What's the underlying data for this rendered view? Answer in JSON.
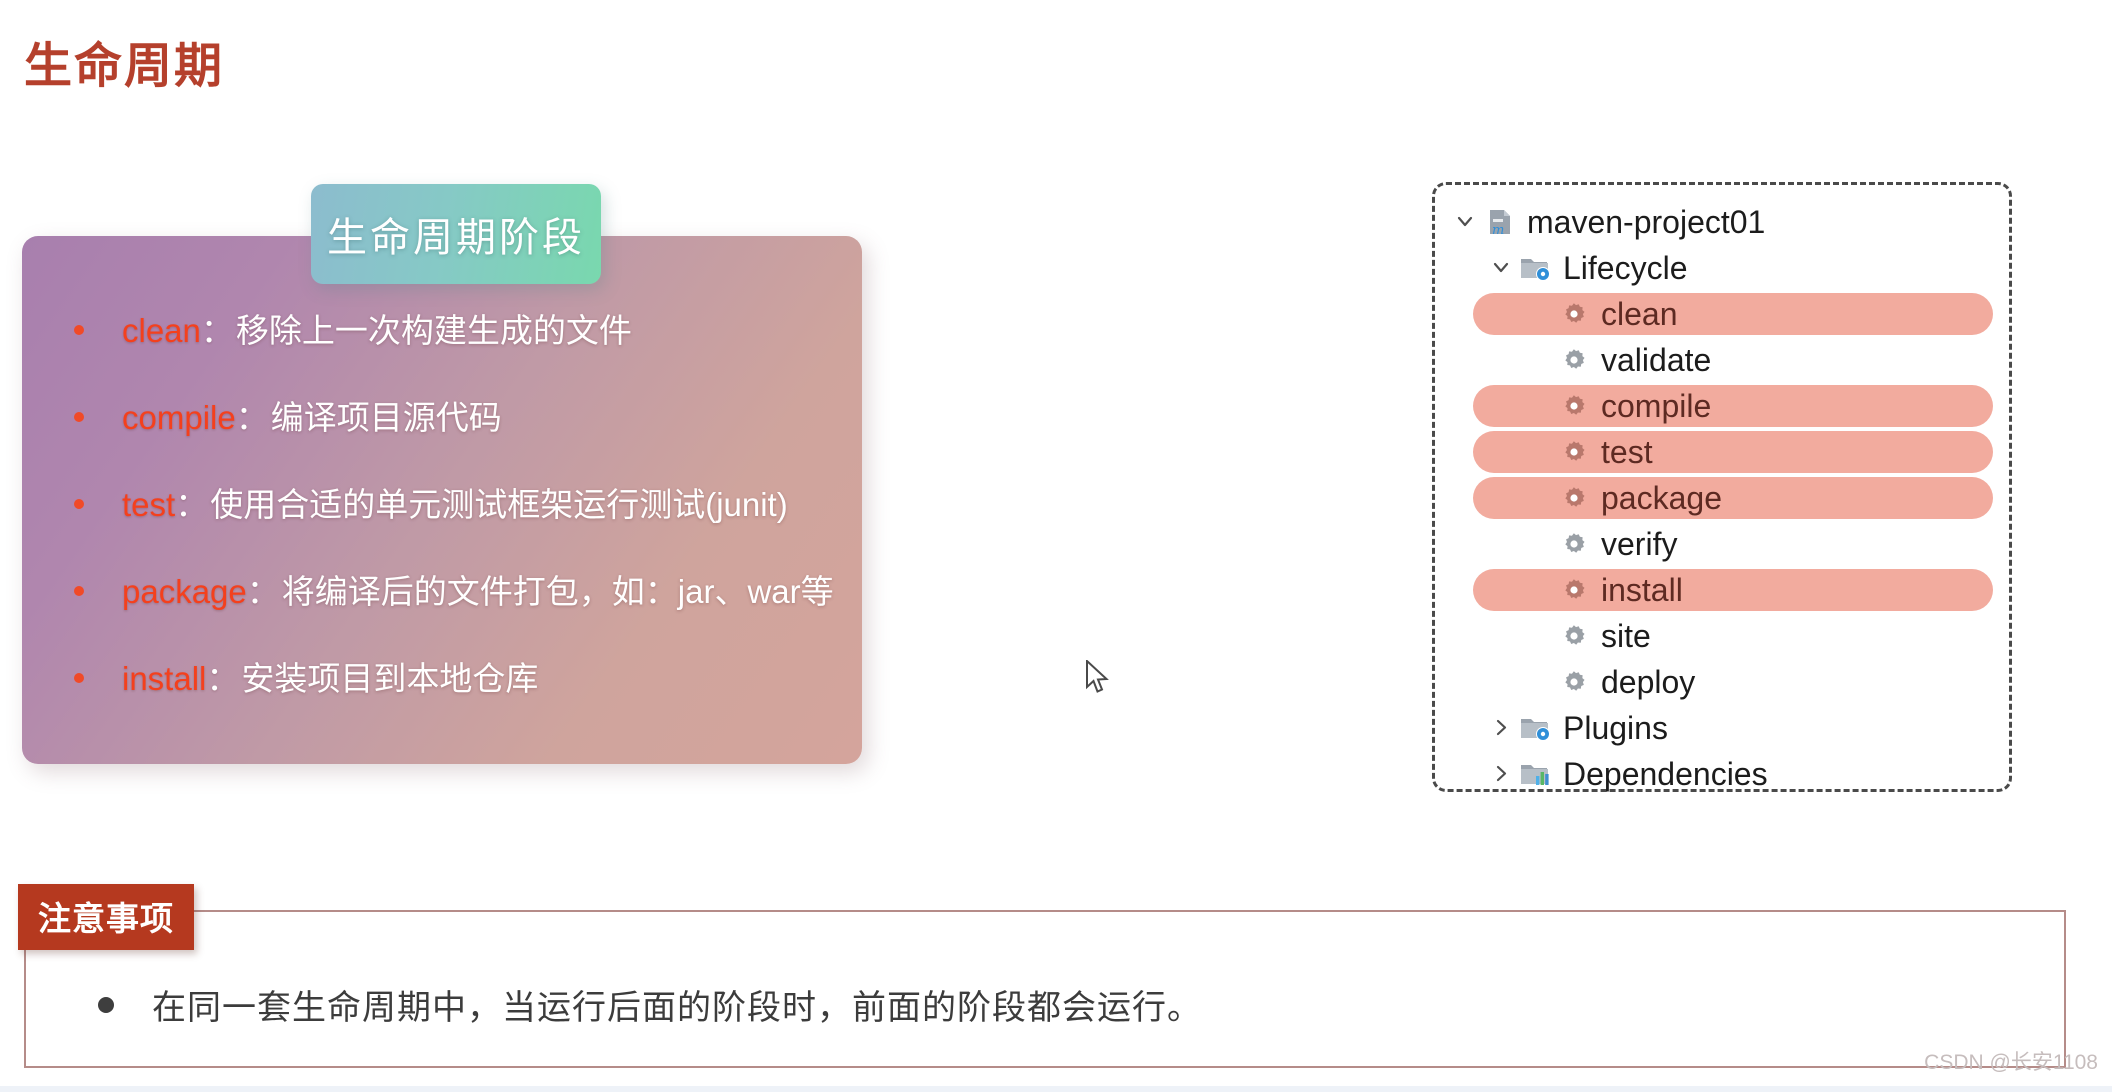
{
  "page": {
    "title": "生命周期",
    "title_color": "#b5402c"
  },
  "lifecycle_card": {
    "tag_label": "生命周期阶段",
    "tag_gradient_from": "#8cbcce",
    "tag_gradient_to": "#79d8ae",
    "card_gradient_from": "#a87fae",
    "card_gradient_to": "#d4a49c",
    "key_color": "#f4401d",
    "desc_color": "#ffffff",
    "items": [
      {
        "key": "clean",
        "colon": "：",
        "desc": "移除上一次构建生成的文件"
      },
      {
        "key": "compile",
        "colon": "：",
        "desc": "编译项目源代码"
      },
      {
        "key": "test",
        "colon": "：",
        "desc": "使用合适的单元测试框架运行测试(junit)"
      },
      {
        "key": "package",
        "colon": "：",
        "desc": "将编译后的文件打包，如：jar、war等"
      },
      {
        "key": "install",
        "colon": "：",
        "desc": "安装项目到本地仓库"
      }
    ]
  },
  "tree_panel": {
    "highlight_color": "#f2ab9e",
    "rows": [
      {
        "label": "maven-project01",
        "level": 0,
        "chevron": "down",
        "icon": "maven-project-icon",
        "highlighted": false
      },
      {
        "label": "Lifecycle",
        "level": 1,
        "chevron": "down",
        "icon": "folder-gear-icon",
        "highlighted": false
      },
      {
        "label": "clean",
        "level": 2,
        "chevron": "none",
        "icon": "gear-icon",
        "highlighted": true
      },
      {
        "label": "validate",
        "level": 2,
        "chevron": "none",
        "icon": "gear-icon",
        "highlighted": false
      },
      {
        "label": "compile",
        "level": 2,
        "chevron": "none",
        "icon": "gear-icon",
        "highlighted": true
      },
      {
        "label": "test",
        "level": 2,
        "chevron": "none",
        "icon": "gear-icon",
        "highlighted": true
      },
      {
        "label": "package",
        "level": 2,
        "chevron": "none",
        "icon": "gear-icon",
        "highlighted": true
      },
      {
        "label": "verify",
        "level": 2,
        "chevron": "none",
        "icon": "gear-icon",
        "highlighted": false
      },
      {
        "label": "install",
        "level": 2,
        "chevron": "none",
        "icon": "gear-icon",
        "highlighted": true
      },
      {
        "label": "site",
        "level": 2,
        "chevron": "none",
        "icon": "gear-icon",
        "highlighted": false
      },
      {
        "label": "deploy",
        "level": 2,
        "chevron": "none",
        "icon": "gear-icon",
        "highlighted": false
      },
      {
        "label": "Plugins",
        "level": 1,
        "chevron": "right",
        "icon": "folder-gear-icon",
        "highlighted": false
      },
      {
        "label": "Dependencies",
        "level": 1,
        "chevron": "right",
        "icon": "folder-chart-icon",
        "highlighted": false
      }
    ]
  },
  "note": {
    "tab_label": "注意事项",
    "tab_color": "#b5391f",
    "border_color": "#b58c89",
    "bullet_text": "在同一套生命周期中，当运行后面的阶段时，前面的阶段都会运行。"
  },
  "watermark": {
    "text": "CSDN @长安1108"
  }
}
